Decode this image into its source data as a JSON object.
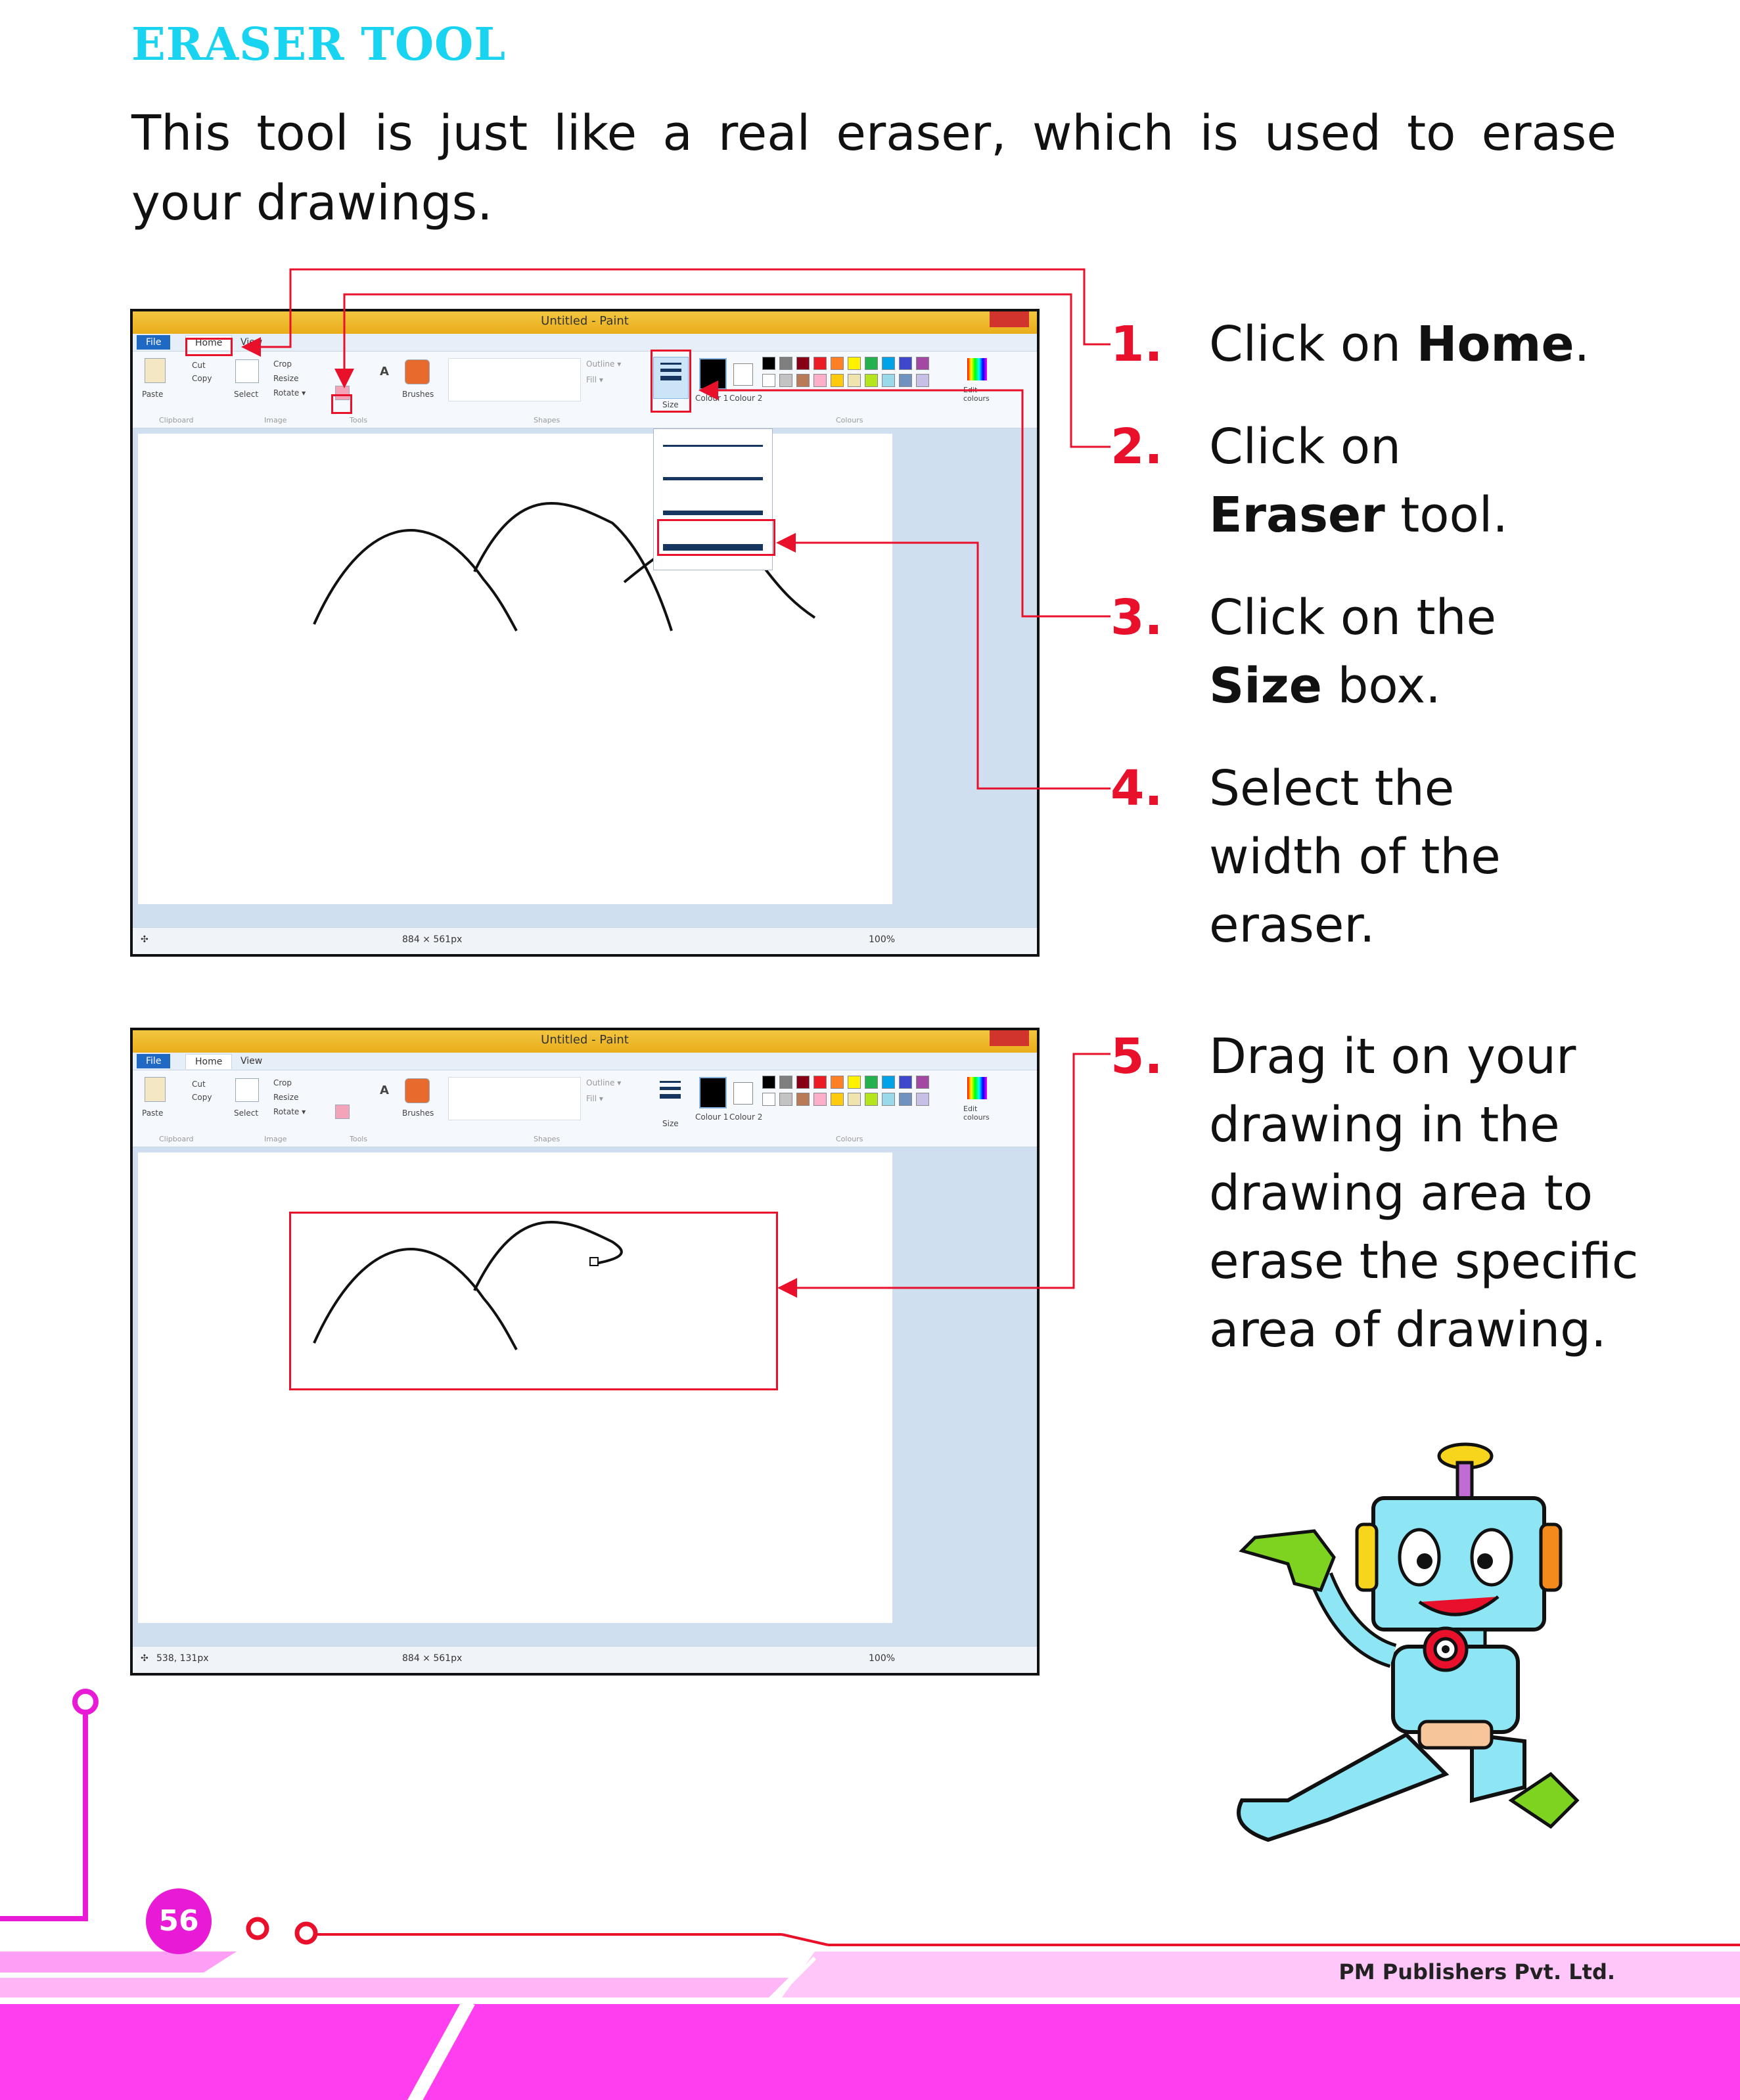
{
  "page": {
    "heading": "ERASER TOOL",
    "intro": "This tool is just like a real eraser, which is used to erase your drawings.",
    "page_number": "56",
    "publisher": "PM Publishers Pvt. Ltd."
  },
  "steps": [
    {
      "num": "1.",
      "pre": "Click on ",
      "bold": "Home",
      "post": "."
    },
    {
      "num": "2.",
      "pre": "Click on ",
      "bold": "Eraser",
      "post": " tool."
    },
    {
      "num": "3.",
      "pre": "Click on the ",
      "bold": "Size",
      "post": " box."
    },
    {
      "num": "4.",
      "pre": "Select the width of the eraser.",
      "bold": "",
      "post": ""
    },
    {
      "num": "5.",
      "pre": "Drag it on your drawing in the drawing area to erase the specific area of drawing.",
      "bold": "",
      "post": ""
    }
  ],
  "paint": {
    "title": "Untitled - Paint",
    "tabs": {
      "file": "File",
      "home": "Home",
      "view": "View"
    },
    "ribbon": {
      "paste": "Paste",
      "cut": "Cut",
      "copy": "Copy",
      "select": "Select",
      "crop": "Crop",
      "resize": "Resize",
      "rotate": "Rotate ▾",
      "brushes": "Brushes",
      "outline": "Outline ▾",
      "fill": "Fill ▾",
      "size": "Size",
      "colour1": "Colour 1",
      "colour2": "Colour 2",
      "edit_colours": "Edit colours",
      "groups": {
        "clipboard": "Clipboard",
        "image": "Image",
        "tools": "Tools",
        "shapes": "Shapes",
        "colours": "Colours"
      }
    },
    "status1": {
      "coords": "",
      "size": "884 × 561px",
      "zoom": "100%"
    },
    "status2": {
      "coords": "538, 131px",
      "size": "884 × 561px",
      "zoom": "100%"
    },
    "palette": [
      "#000000",
      "#7f7f7f",
      "#880015",
      "#ed1c24",
      "#ff7f27",
      "#fff200",
      "#22b14c",
      "#00a2e8",
      "#3f48cc",
      "#a349a4"
    ],
    "palette2": [
      "#ffffff",
      "#c3c3c3",
      "#b97a57",
      "#ffaec9",
      "#ffc90e",
      "#efe4b0",
      "#b5e61d",
      "#99d9ea",
      "#7092be",
      "#c8bfe7"
    ]
  },
  "colors": {
    "heading": "#19d4f0",
    "accent_red": "#e8102a",
    "magenta": "#e91ad6",
    "footer_band": "#ff3ef0"
  }
}
